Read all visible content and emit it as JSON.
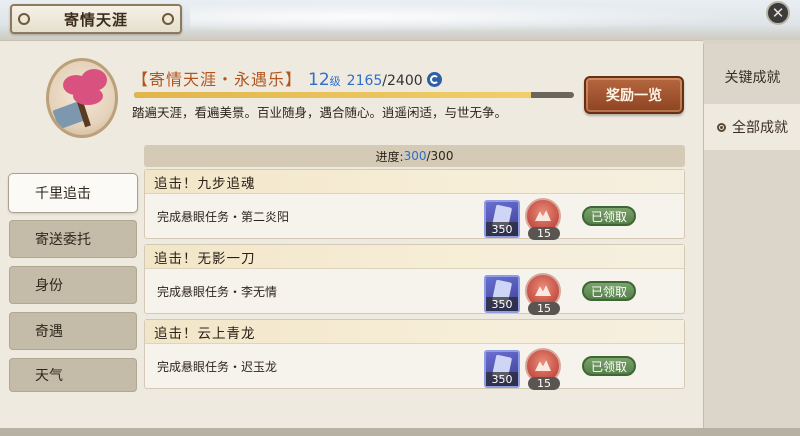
{
  "window": {
    "title": "寄情天涯",
    "close_icon": "close-icon"
  },
  "right_tabs": [
    {
      "label": "关键成就",
      "selected": false
    },
    {
      "label": "全部成就",
      "selected": true
    }
  ],
  "header": {
    "name": "【寄情天涯・永遇乐】",
    "level": "12",
    "level_unit": "级",
    "exp_current": "2165",
    "exp_total": "/2400",
    "exp_fraction": 0.902,
    "description": "踏遍天涯，看遍美景。百业随身，遇合随心。逍遥闲适，与世无争。",
    "reward_button": "奖励一览"
  },
  "progress": {
    "label": "进度:",
    "current": "300",
    "total": "/300"
  },
  "categories": [
    {
      "label": "千里追击",
      "active": true
    },
    {
      "label": "寄送委托",
      "active": false
    },
    {
      "label": "身份",
      "active": false
    },
    {
      "label": "奇遇",
      "active": false
    },
    {
      "label": "天气",
      "active": false
    }
  ],
  "achievements": [
    {
      "title": "追击！九步追魂",
      "task": "完成悬眼任务・第二炎阳",
      "reward1_count": "350",
      "reward2_count": "15",
      "status": "已领取"
    },
    {
      "title": "追击！无影一刀",
      "task": "完成悬眼任务・李无情",
      "reward1_count": "350",
      "reward2_count": "15",
      "status": "已领取"
    },
    {
      "title": "追击！云上青龙",
      "task": "完成悬眼任务・迟玉龙",
      "reward1_count": "350",
      "reward2_count": "15",
      "status": "已领取"
    }
  ],
  "colors": {
    "accent_orange": "#b3541e",
    "accent_blue": "#2f6ec9",
    "claimed_green": "#56804a",
    "reward_button": "#8e4322"
  }
}
